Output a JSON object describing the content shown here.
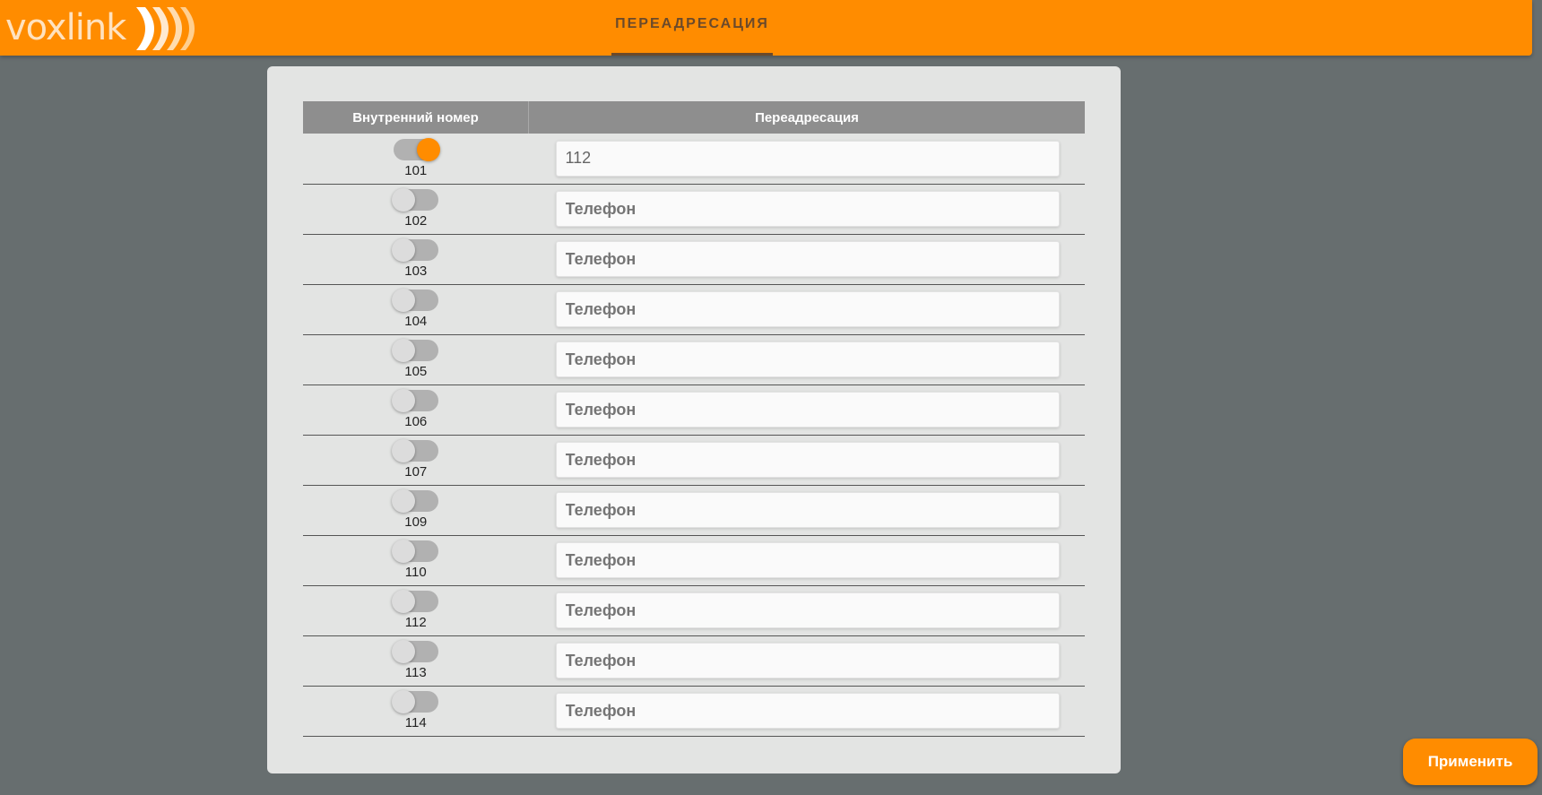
{
  "header": {
    "logo_text": "voxlink",
    "nav_tab": "ПЕРЕАДРЕСАЦИЯ"
  },
  "table": {
    "col_extension": "Внутренний номер",
    "col_forward": "Переадресация",
    "rows": [
      {
        "ext": "101",
        "enabled": true,
        "value": "112",
        "placeholder": "Телефон"
      },
      {
        "ext": "102",
        "enabled": false,
        "value": "",
        "placeholder": "Телефон"
      },
      {
        "ext": "103",
        "enabled": false,
        "value": "",
        "placeholder": "Телефон"
      },
      {
        "ext": "104",
        "enabled": false,
        "value": "",
        "placeholder": "Телефон"
      },
      {
        "ext": "105",
        "enabled": false,
        "value": "",
        "placeholder": "Телефон"
      },
      {
        "ext": "106",
        "enabled": false,
        "value": "",
        "placeholder": "Телефон"
      },
      {
        "ext": "107",
        "enabled": false,
        "value": "",
        "placeholder": "Телефон"
      },
      {
        "ext": "109",
        "enabled": false,
        "value": "",
        "placeholder": "Телефон"
      },
      {
        "ext": "110",
        "enabled": false,
        "value": "",
        "placeholder": "Телефон"
      },
      {
        "ext": "112",
        "enabled": false,
        "value": "",
        "placeholder": "Телефон"
      },
      {
        "ext": "113",
        "enabled": false,
        "value": "",
        "placeholder": "Телефон"
      },
      {
        "ext": "114",
        "enabled": false,
        "value": "",
        "placeholder": "Телефон"
      }
    ]
  },
  "apply_button": "Применить",
  "colors": {
    "accent": "#ff8c00",
    "background": "#676e6f",
    "panel": "#e3e4e3",
    "table_header": "#8e8e8e"
  }
}
